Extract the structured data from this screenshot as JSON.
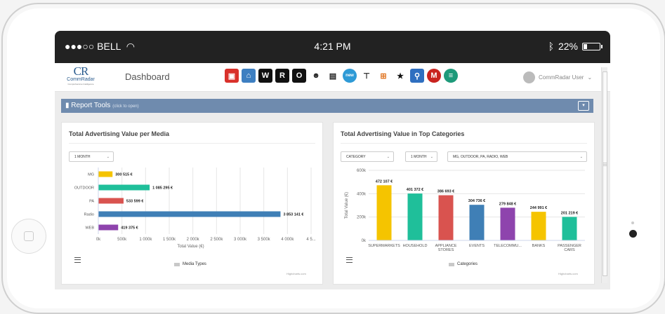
{
  "statusbar": {
    "carrier": "●●●○○ BELL",
    "time": "4:21 PM",
    "battery_pct": "22%",
    "battery_level": 0.22
  },
  "app": {
    "logo_mark": "CR",
    "logo_name": "CommRadar",
    "logo_sub": "Comprehensive Intelligence",
    "page_title": "Dashboard",
    "user_name": "CommRadar User"
  },
  "toolbar": [
    {
      "name": "save-icon",
      "color": "#d9312b",
      "glyph": "▣",
      "circle": false
    },
    {
      "name": "home-icon",
      "color": "#3d7fc1",
      "glyph": "⌂",
      "circle": false
    },
    {
      "name": "w-icon",
      "color": "#111111",
      "glyph": "W",
      "circle": false
    },
    {
      "name": "r-icon",
      "color": "#111111",
      "glyph": "R",
      "circle": false
    },
    {
      "name": "o-icon",
      "color": "#111111",
      "glyph": "O",
      "circle": false
    },
    {
      "name": "people-icon",
      "color": "#ffffff",
      "glyph": "☻",
      "circle": false,
      "fg": "#222222"
    },
    {
      "name": "document-icon",
      "color": "#ffffff",
      "glyph": "▤",
      "circle": false,
      "fg": "#222222"
    },
    {
      "name": "new-icon",
      "color": "#2e9ad6",
      "glyph": "new",
      "circle": true
    },
    {
      "name": "outdoor-icon",
      "color": "#ffffff",
      "glyph": "⊤",
      "circle": false,
      "fg": "#222222"
    },
    {
      "name": "hierarchy-icon",
      "color": "#ffffff",
      "glyph": "⊞",
      "circle": false,
      "fg": "#e0731f"
    },
    {
      "name": "top-star-icon",
      "color": "#ffffff",
      "glyph": "★",
      "circle": false,
      "fg": "#111111"
    },
    {
      "name": "search-icon",
      "color": "#2f6fc0",
      "glyph": "⚲",
      "circle": false
    },
    {
      "name": "m-icon",
      "color": "#c9231f",
      "glyph": "M",
      "circle": true
    },
    {
      "name": "report-icon",
      "color": "#1e9a7a",
      "glyph": "≡",
      "circle": true
    }
  ],
  "report_tools": {
    "label": "Report Tools",
    "hint": "(click to open)",
    "button": "▾"
  },
  "panel_left": {
    "title": "Total Advertising Value per Media",
    "period_select": "1 MONTH",
    "legend": "Media Types",
    "credit": "Highcharts.com"
  },
  "panel_right": {
    "title": "Total Advertising Value in Top Categories",
    "category_select": "CATEGORY",
    "period_select": "1 MONTH",
    "media_select": "MG, OUTDOOR, PA, RADIO, WEB",
    "legend": "Categories",
    "credit": "Highcharts.com"
  },
  "chart_data": [
    {
      "type": "bar",
      "orientation": "horizontal",
      "categories": [
        "MG",
        "OUTDOOR",
        "PA",
        "Radio",
        "WEB"
      ],
      "values": [
        300515,
        1085295,
        533599,
        3853141,
        419375
      ],
      "value_labels": [
        "300 515 €",
        "1 085 295 €",
        "533 599 €",
        "3 853 141 €",
        "419 375 €"
      ],
      "colors": [
        "#f5c400",
        "#1fbf9a",
        "#d9534f",
        "#3f7fb6",
        "#8e44ad"
      ],
      "xlim": [
        0,
        4500000
      ],
      "x_ticks": [
        "0k",
        "500k",
        "1 000k",
        "1 500k",
        "2 000k",
        "2 500k",
        "3 000k",
        "3 500k",
        "4 000k",
        "4 5..."
      ],
      "xlabel": "Total Value (€)",
      "legend": "Media Types",
      "grid": true
    },
    {
      "type": "bar",
      "orientation": "vertical",
      "categories": [
        "SUPERMARKETS",
        "HOUSEHOLD",
        "APPLIANCE\nSTORES",
        "EVENTS",
        "TELECOMMU...",
        "BANKS",
        "PASSENGER\nCARS"
      ],
      "values": [
        472107,
        401372,
        386693,
        304736,
        279848,
        244991,
        201219
      ],
      "value_labels": [
        "472 107 €",
        "401 372 €",
        "386 693 €",
        "304 736 €",
        "279 848 €",
        "244 991 €",
        "201 219 €"
      ],
      "colors": [
        "#f5c400",
        "#1fbf9a",
        "#d9534f",
        "#3f7fb6",
        "#8e44ad",
        "#f5c400",
        "#1fbf9a"
      ],
      "ylim": [
        0,
        600000
      ],
      "y_ticks": [
        "0k",
        "200k",
        "400k",
        "600k"
      ],
      "ylabel": "Total Value (€)",
      "legend": "Categories",
      "grid": true
    }
  ]
}
